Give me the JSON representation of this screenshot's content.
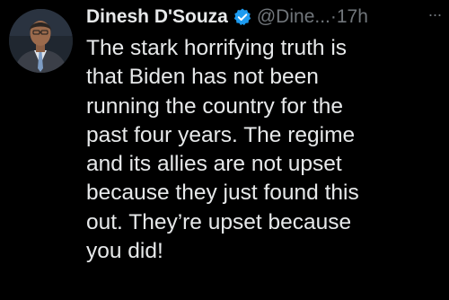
{
  "author": {
    "name": "Dinesh D'Souza",
    "handle": "@Dine...",
    "separator": "·",
    "time": "17h",
    "verified_color": "#1d9bf0"
  },
  "menu": {
    "more_label": "···"
  },
  "tweet": {
    "lines": [
      "The stark horrifying truth is",
      "that Biden has not been",
      "running the country for the",
      "past four years. The regime",
      "and its allies are not upset",
      "because they just found this",
      "out. They’re upset because",
      "you did!"
    ]
  },
  "colors": {
    "background": "#000000",
    "text": "#e7e9ea",
    "secondary": "#71767b"
  }
}
